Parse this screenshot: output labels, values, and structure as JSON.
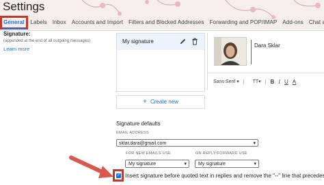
{
  "page": {
    "title": "Settings",
    "tabs": [
      {
        "label": "General",
        "active": true
      },
      {
        "label": "Labels"
      },
      {
        "label": "Inbox"
      },
      {
        "label": "Accounts and Import"
      },
      {
        "label": "Filters and Blocked Addresses"
      },
      {
        "label": "Forwarding and POP/IMAP"
      },
      {
        "label": "Add-ons"
      },
      {
        "label": "Chat and"
      }
    ]
  },
  "signature": {
    "label": "Signature:",
    "sublabel": "(appended at the end of all outgoing messages)",
    "learn_more": "Learn more",
    "items": [
      {
        "name": "My signature"
      }
    ],
    "editor": {
      "name": "Dara Sklar",
      "font": "Sans Serif",
      "toolbar": {
        "size": "TT",
        "bold": "B",
        "italic": "I",
        "underline": "U",
        "text_color": "A"
      }
    },
    "create_new": "Create new"
  },
  "defaults": {
    "title": "Signature defaults",
    "email_label": "EMAIL ADDRESS",
    "email_value": "sklar.dara@gmail.com",
    "new_label": "FOR NEW EMAILS USE",
    "new_value": "My signature",
    "reply_label": "ON REPLY/FORWARD USE",
    "reply_value": "My signature",
    "insert_checked": true,
    "insert_text": "Insert signature before quoted text in replies and remove the \"--\" line that precedes it."
  },
  "colors": {
    "accent": "#1a73e8",
    "highlight": "#c0392b",
    "header_bg": "#f6eded"
  }
}
